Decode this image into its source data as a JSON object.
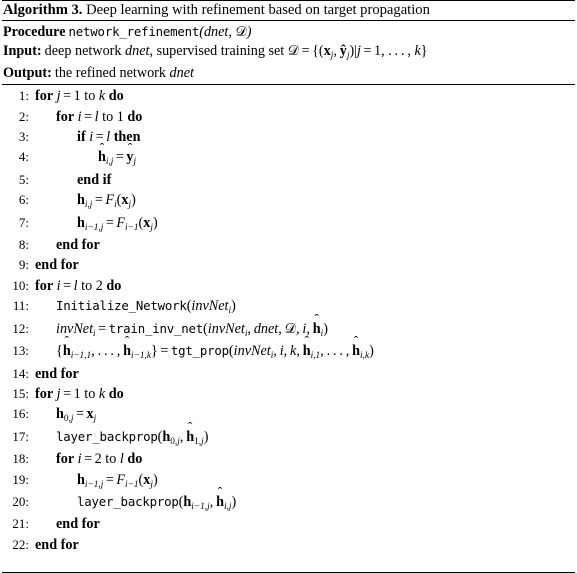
{
  "algorithm": {
    "label": "Algorithm 3.",
    "title": "Deep learning with refinement based on target propagation",
    "header": {
      "procedure_label": "Procedure",
      "procedure_name": "network_refinement",
      "procedure_args": "(dnet, D)",
      "input_label": "Input:",
      "input_text": "deep network dnet, supervised training set D = {(x_j, ŷ_j)|j = 1, … , k}",
      "output_label": "Output:",
      "output_text": "the refined network dnet"
    },
    "lines": [
      {
        "no": "1:",
        "indent": 0,
        "text": "for j = 1 to k do"
      },
      {
        "no": "2:",
        "indent": 1,
        "text": "for i = l to 1 do"
      },
      {
        "no": "3:",
        "indent": 2,
        "text": "if i = l then"
      },
      {
        "no": "4:",
        "indent": 3,
        "text": "ĥ_{i,j} = ŷ_j"
      },
      {
        "no": "5:",
        "indent": 2,
        "text": "end if"
      },
      {
        "no": "6:",
        "indent": 2,
        "text": "h_{i,j} = F_i(x_j)"
      },
      {
        "no": "7:",
        "indent": 2,
        "text": "h_{i-1,j} = F_{i-1}(x_j)"
      },
      {
        "no": "8:",
        "indent": 1,
        "text": "end for"
      },
      {
        "no": "9:",
        "indent": 0,
        "text": "end for"
      },
      {
        "no": "10:",
        "indent": 0,
        "text": "for i = l to 2 do"
      },
      {
        "no": "11:",
        "indent": 1,
        "text": "Initialize_Network(invNet_i)"
      },
      {
        "no": "12:",
        "indent": 1,
        "text": "invNet_i = train_inv_net(invNet_i, dnet, D, i, ĥ_i)"
      },
      {
        "no": "13:",
        "indent": 1,
        "text": "{ĥ_{i-1,1}, … , ĥ_{i-1,k}} = tgt_prop(invNet_i, i, k, ĥ_{i,1}, … , ĥ_{i,k})"
      },
      {
        "no": "14:",
        "indent": 0,
        "text": "end for"
      },
      {
        "no": "15:",
        "indent": 0,
        "text": "for j = 1 to k do"
      },
      {
        "no": "16:",
        "indent": 1,
        "text": "h_{0,j} = x_j"
      },
      {
        "no": "17:",
        "indent": 1,
        "text": "layer_backprop(h_{0,j}, ĥ_{1,j})"
      },
      {
        "no": "18:",
        "indent": 1,
        "text": "for i = 2 to l do"
      },
      {
        "no": "19:",
        "indent": 2,
        "text": "h_{i-1,j} = F_{i-1}(x_j)"
      },
      {
        "no": "20:",
        "indent": 2,
        "text": "layer_backprop(h_{i-1,j}, ĥ_{i,j})"
      },
      {
        "no": "21:",
        "indent": 1,
        "text": "end for"
      },
      {
        "no": "22:",
        "indent": 0,
        "text": "end for"
      }
    ]
  }
}
